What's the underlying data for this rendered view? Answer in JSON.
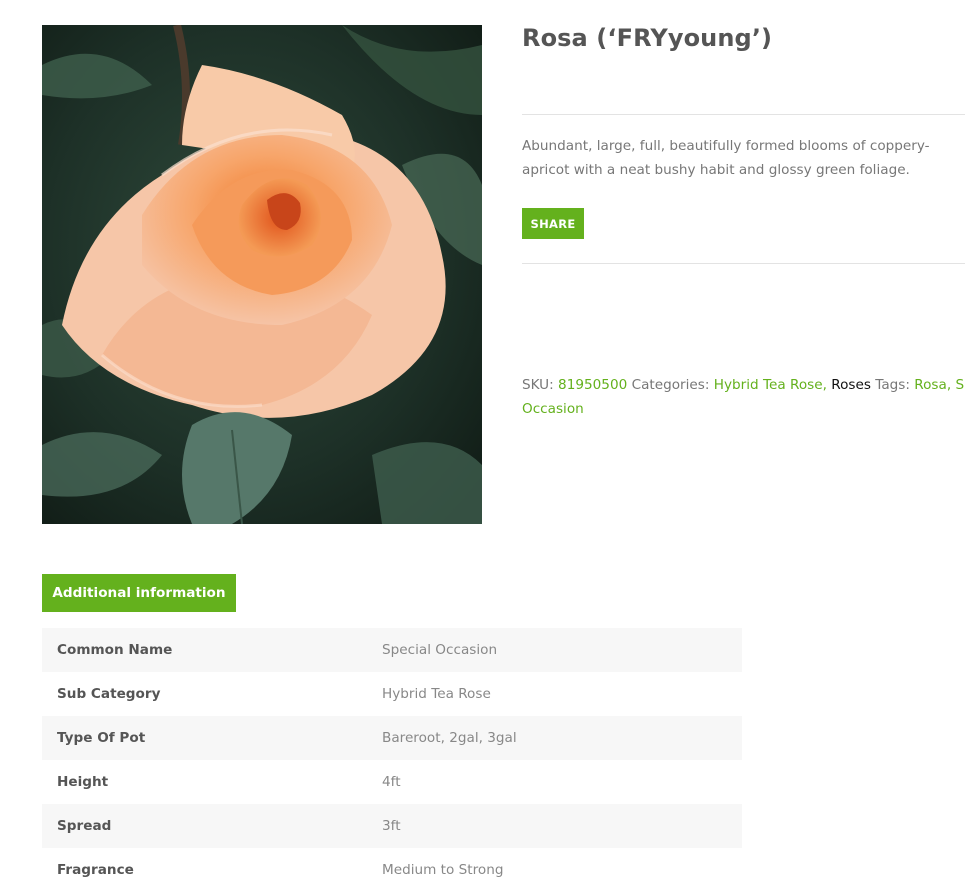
{
  "product": {
    "title": "Rosa (‘FRYyoung’)",
    "description": "Abundant, large, full, beautifully formed blooms of coppery-apricot with a neat bushy habit and glossy green foliage.",
    "share_label": "SHARE",
    "image_alt": "Peach rose bloom"
  },
  "meta": {
    "sku_label": "SKU:",
    "sku": "81950500",
    "categories_label": "Categories:",
    "categories": [
      "Hybrid Tea Rose",
      "Roses"
    ],
    "separator": ",",
    "tags_label": "Tags:",
    "tags": [
      "Rosa",
      "Special Occasion"
    ],
    "tags_visible_line1": [
      "Rosa",
      "Speci"
    ],
    "tags_visible_line2": "Occasion"
  },
  "tabs": {
    "additional_info_label": "Additional information"
  },
  "attributes": [
    {
      "label": "Common Name",
      "value": "Special Occasion"
    },
    {
      "label": "Sub Category",
      "value": "Hybrid Tea Rose"
    },
    {
      "label": "Type Of Pot",
      "value": "Bareroot, 2gal, 3gal"
    },
    {
      "label": "Height",
      "value": "4ft"
    },
    {
      "label": "Spread",
      "value": "3ft"
    },
    {
      "label": "Fragrance",
      "value": "Medium to Strong"
    }
  ],
  "colors": {
    "accent": "#64b11d",
    "text": "#777777",
    "heading": "#555555",
    "row_stripe": "#f7f7f7"
  }
}
